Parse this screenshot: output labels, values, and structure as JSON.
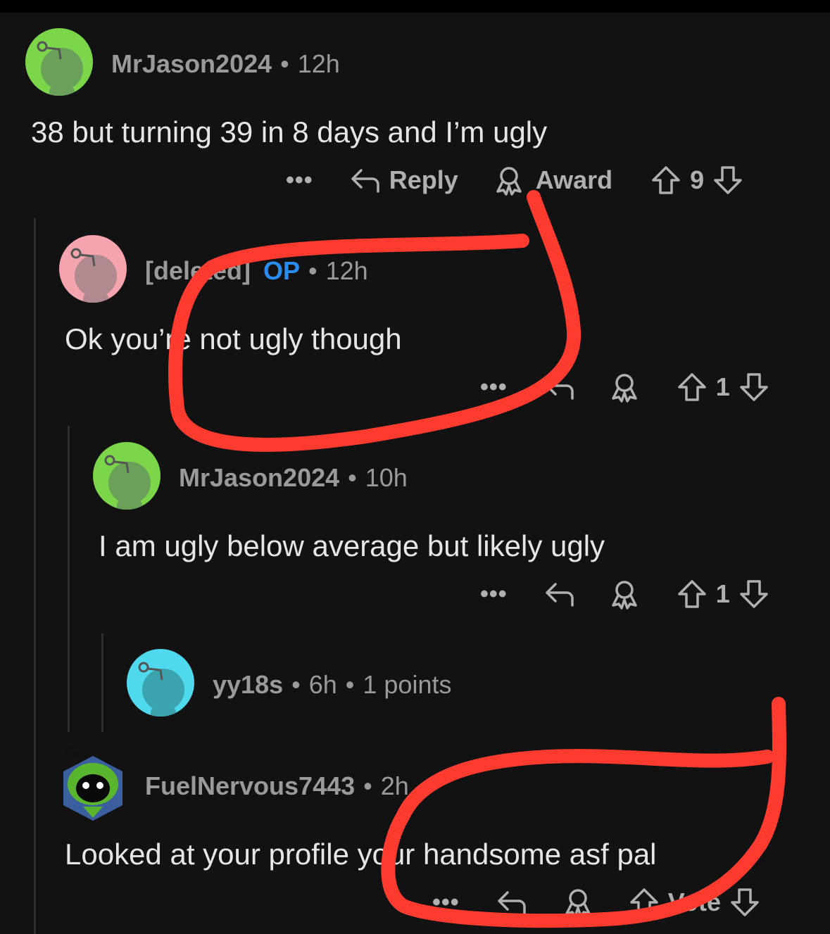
{
  "comments": [
    {
      "username": "MrJason2024",
      "time": "12h",
      "text": "38 but turning 39 in 8 days and I’m ugly",
      "reply_label": "Reply",
      "award_label": "Award",
      "score": "9"
    },
    {
      "username": "[deleted]",
      "badge": "OP",
      "time": "12h",
      "text": "Ok you’re not ugly though",
      "score": "1"
    },
    {
      "username": "MrJason2024",
      "time": "10h",
      "text": "I am ugly below average but likely ugly",
      "score": "1"
    },
    {
      "username": "yy18s",
      "time": "6h",
      "points": "1 points"
    },
    {
      "username": "FuelNervous7443",
      "time": "2h",
      "text": "Looked at your profile your handsome asf pal",
      "vote_label": "Vote"
    }
  ],
  "more_label": "•••",
  "separator": "•",
  "colors": {
    "background": "#121212",
    "annotation": "#ff3b30",
    "op_badge": "#2a8cf0",
    "avatar_green": "#7bd64a",
    "avatar_pink": "#f5a3ad",
    "avatar_cyan": "#4fd9ee"
  }
}
